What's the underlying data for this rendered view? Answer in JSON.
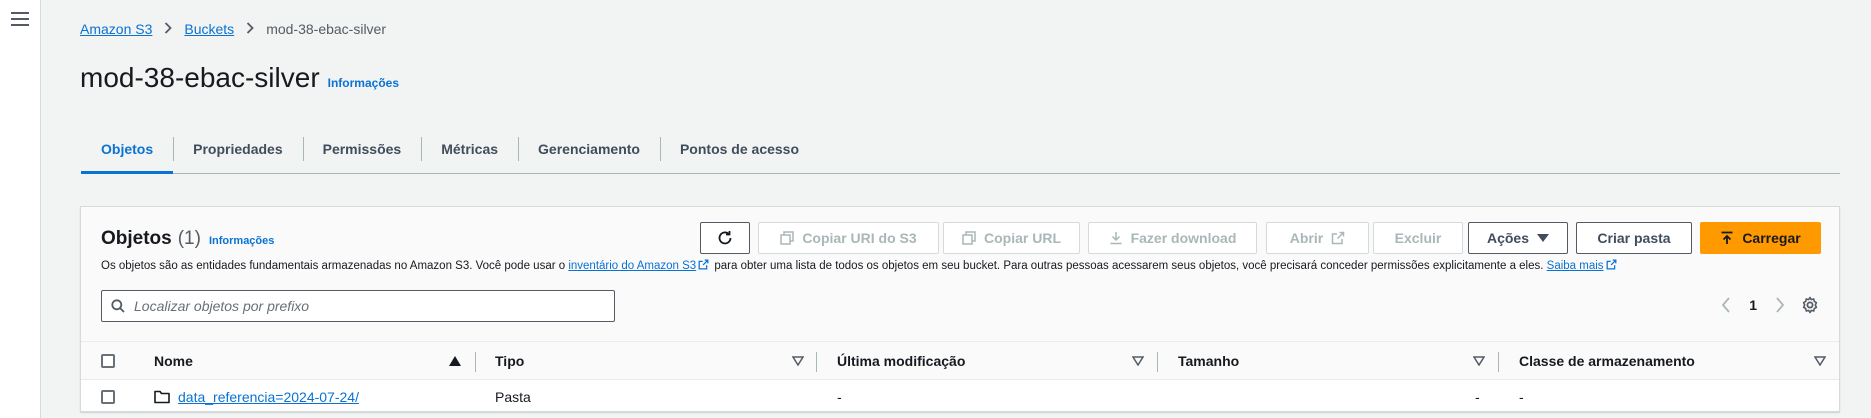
{
  "breadcrumb": {
    "root": "Amazon S3",
    "buckets": "Buckets",
    "current": "mod-38-ebac-silver"
  },
  "page": {
    "title": "mod-38-ebac-silver",
    "info": "Informações"
  },
  "tabs": [
    "Objetos",
    "Propriedades",
    "Permissões",
    "Métricas",
    "Gerenciamento",
    "Pontos de acesso"
  ],
  "objects_panel": {
    "title": "Objetos",
    "count": "(1)",
    "info": "Informações",
    "description": {
      "part1": "Os objetos são as entidades fundamentais armazenadas no Amazon S3. Você pode usar o ",
      "link1": "inventário do Amazon S3",
      "part2": " para obter uma lista de todos os objetos em seu bucket. Para outras pessoas acessarem seus objetos, você precisará conceder permissões explicitamente a eles. ",
      "link2": "Saiba mais"
    },
    "buttons": {
      "copy_uri": "Copiar URI do S3",
      "copy_url": "Copiar URL",
      "download": "Fazer download",
      "open": "Abrir",
      "delete": "Excluir",
      "actions": "Ações",
      "create_folder": "Criar pasta",
      "upload": "Carregar"
    },
    "search": {
      "placeholder": "Localizar objetos por prefixo",
      "value": ""
    },
    "pagination": {
      "page": "1"
    }
  },
  "table": {
    "columns": [
      "Nome",
      "Tipo",
      "Última modificação",
      "Tamanho",
      "Classe de armazenamento"
    ],
    "rows": [
      {
        "name": "data_referencia=2024-07-24/",
        "type": "Pasta",
        "modified": "-",
        "size": "-",
        "storage_class": "-"
      }
    ]
  },
  "colors": {
    "accent": "#0972d3",
    "primary_button": "#ff9900",
    "background": "#f2f3f3"
  },
  "icons": [
    "menu-icon",
    "chevron-right-icon",
    "refresh-icon",
    "copy-icon",
    "download-icon",
    "external-link-icon",
    "caret-down-icon",
    "upload-icon",
    "search-icon",
    "angle-left-icon",
    "angle-right-icon",
    "gear-icon",
    "sort-asc-icon",
    "folder-icon"
  ]
}
